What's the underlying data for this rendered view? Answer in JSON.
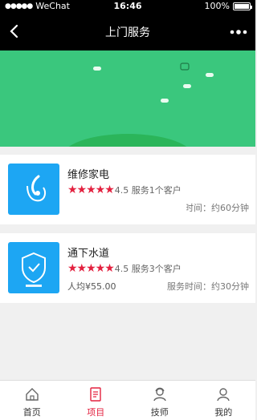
{
  "status_bar": {
    "carrier": "WeChat",
    "signal_dots": "●●●●●",
    "time": "16:46",
    "battery": "100%"
  },
  "nav": {
    "title": "上门服务"
  },
  "services": [
    {
      "title": "维修家电",
      "stars": "★★★★★",
      "rating": "4.5",
      "served": "服务1个客户",
      "price": "",
      "time": "时间：约60分钟",
      "icon": "appliance-repair-icon"
    },
    {
      "title": "通下水道",
      "stars": "★★★★★",
      "rating": "4.5",
      "served": "服务3个客户",
      "price": "人均¥55.00",
      "time": "服务时间：约30分钟",
      "icon": "shield-drain-icon"
    }
  ],
  "tabbar": {
    "items": [
      {
        "label": "首页",
        "icon": "home-icon"
      },
      {
        "label": "项目",
        "icon": "document-icon"
      },
      {
        "label": "技师",
        "icon": "technician-icon"
      },
      {
        "label": "我的",
        "icon": "profile-icon"
      }
    ],
    "active": 1
  },
  "colors": {
    "banner": "#3ac77d",
    "accent": "#e3213f",
    "thumb": "#1da6f3"
  }
}
